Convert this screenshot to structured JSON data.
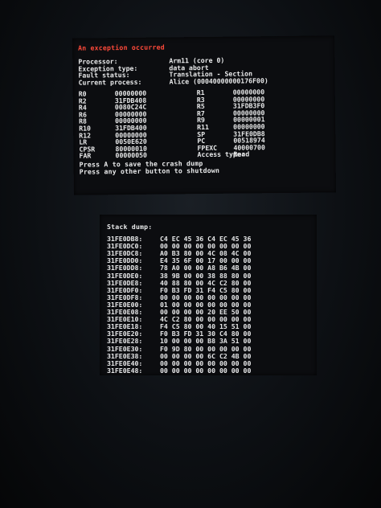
{
  "exception": {
    "title": "An exception occurred",
    "info": [
      {
        "label": "Processor:",
        "value": "Arm11 (core 0)"
      },
      {
        "label": "Exception type:",
        "value": "data abort"
      },
      {
        "label": "Fault status:",
        "value": "Translation - Section"
      },
      {
        "label": "Current process:",
        "value": "Alice (00040000000176F00)"
      }
    ],
    "registers": [
      [
        "R0",
        "00000000",
        "R1",
        "00000000"
      ],
      [
        "R2",
        "31FDB408",
        "R3",
        "00000000"
      ],
      [
        "R4",
        "0080C24C",
        "R5",
        "31FDB3F0"
      ],
      [
        "R6",
        "00000000",
        "R7",
        "00000000"
      ],
      [
        "R8",
        "00000000",
        "R9",
        "00000001"
      ],
      [
        "R10",
        "31FDB400",
        "R11",
        "00000000"
      ],
      [
        "R12",
        "00000000",
        "SP",
        "31FE0DB8"
      ],
      [
        "LR",
        "0050E620",
        "PC",
        "00518974"
      ],
      [
        "CPSR",
        "80000010",
        "FPEXC",
        "40000700"
      ],
      [
        "FAR",
        "00000050",
        "Access type:",
        "Read"
      ]
    ],
    "prompt_save": "Press A to save the crash dump",
    "prompt_shutdown": "Press any other button to shutdown"
  },
  "stack": {
    "title": "Stack dump:",
    "rows": [
      {
        "addr": "31FE0DB8:",
        "bytes": "C4 EC 45 36 C4 EC 45 36"
      },
      {
        "addr": "31FE0DC0:",
        "bytes": "00 00 00 00 00 00 00 00"
      },
      {
        "addr": "31FE0DC8:",
        "bytes": "A0 B3 80 00 4C 08 4C 00"
      },
      {
        "addr": "31FE0DD0:",
        "bytes": "E4 35 6F 00 17 00 00 00"
      },
      {
        "addr": "31FE0DD8:",
        "bytes": "78 A0 00 00 A8 B6 4B 00"
      },
      {
        "addr": "31FE0DE0:",
        "bytes": "38 9B 00 00 38 88 80 00"
      },
      {
        "addr": "31FE0DE8:",
        "bytes": "40 88 80 00 4C C2 80 00"
      },
      {
        "addr": "31FE0DF0:",
        "bytes": "F0 B3 FD 31 F4 C5 80 00"
      },
      {
        "addr": "31FE0DF8:",
        "bytes": "00 00 00 00 00 00 00 00"
      },
      {
        "addr": "31FE0E00:",
        "bytes": "01 00 00 00 00 00 00 00"
      },
      {
        "addr": "31FE0E08:",
        "bytes": "00 00 00 00 20 EE 50 00"
      },
      {
        "addr": "31FE0E10:",
        "bytes": "4C C2 80 00 00 00 00 00"
      },
      {
        "addr": "31FE0E18:",
        "bytes": "F4 C5 80 00 40 15 51 00"
      },
      {
        "addr": "31FE0E20:",
        "bytes": "F0 B3 FD 31 30 C4 80 00"
      },
      {
        "addr": "31FE0E28:",
        "bytes": "10 00 00 00 B8 3A 51 00"
      },
      {
        "addr": "31FE0E30:",
        "bytes": "F0 9D 80 00 00 00 00 00"
      },
      {
        "addr": "31FE0E38:",
        "bytes": "00 00 00 00 6C C2 4B 00"
      },
      {
        "addr": "31FE0E40:",
        "bytes": "00 00 00 00 00 00 00 00"
      },
      {
        "addr": "31FE0E48:",
        "bytes": "00 00 00 00 00 00 00 00"
      }
    ]
  }
}
